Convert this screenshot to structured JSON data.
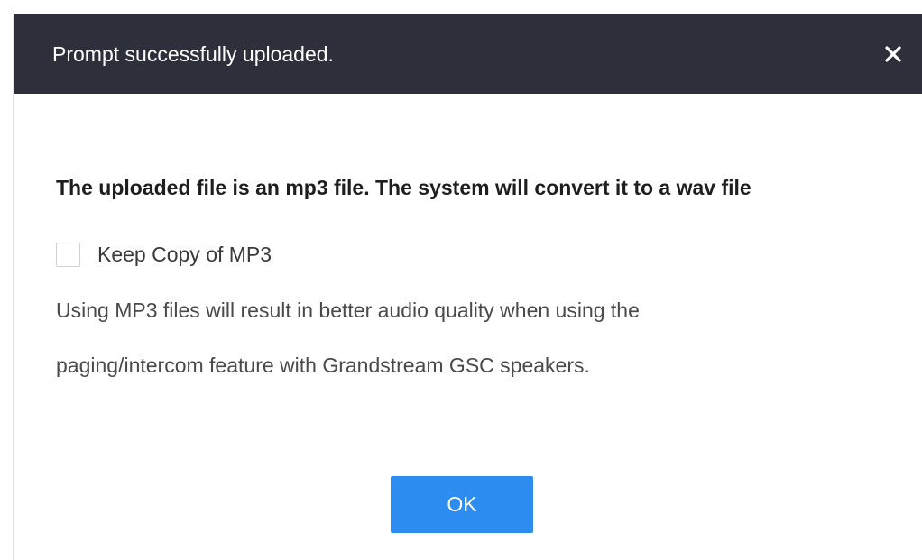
{
  "dialog": {
    "title": "Prompt successfully uploaded.",
    "close_icon": "close-icon",
    "message": "The uploaded file is an mp3 file. The system will convert it to a wav file",
    "checkbox": {
      "label": "Keep Copy of MP3",
      "checked": false
    },
    "info_lines": [
      "Using MP3 files will result in better audio quality when using the",
      "paging/intercom feature with Grandstream GSC speakers."
    ],
    "ok_label": "OK"
  },
  "colors": {
    "header_background": "#2d303b",
    "primary_button": "#2d8cf0"
  }
}
